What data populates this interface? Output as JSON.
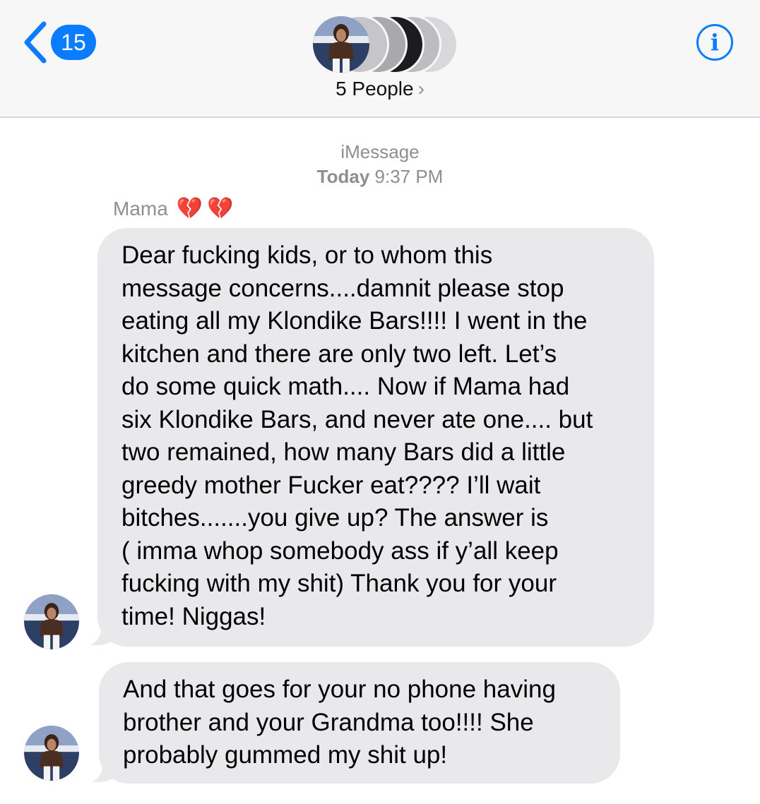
{
  "header": {
    "back_count": "15",
    "group_label": "5 People",
    "group_chevron": "›",
    "info_icon": "i"
  },
  "conversation": {
    "service": "iMessage",
    "day": "Today",
    "time": "9:37 PM"
  },
  "sender": {
    "name": "Mama",
    "emoji": "💔💔"
  },
  "messages": [
    {
      "lines": [
        "Dear fucking kids, or to whom this",
        "message concerns....damnit please stop",
        "eating all my Klondike Bars!!!! I went in the",
        "kitchen and there are only two left. Let’s",
        "do some quick math.... Now if Mama had",
        "six Klondike Bars, and never ate one.... but",
        "two remained, how many Bars did a little",
        "greedy mother Fucker eat???? I’ll wait",
        "bitches.......you give up? The answer is",
        "( imma whop somebody ass if y’all keep",
        "fucking with my shit) Thank you for your",
        "time! Niggas!"
      ]
    },
    {
      "lines": [
        "And that goes for your no phone having",
        "brother and your Grandma too!!!! She",
        "probably gummed my shit up!"
      ]
    }
  ],
  "colors": {
    "accent": "#0a7cff",
    "bubble": "#e9e9eb",
    "meta": "#8e8e93"
  }
}
